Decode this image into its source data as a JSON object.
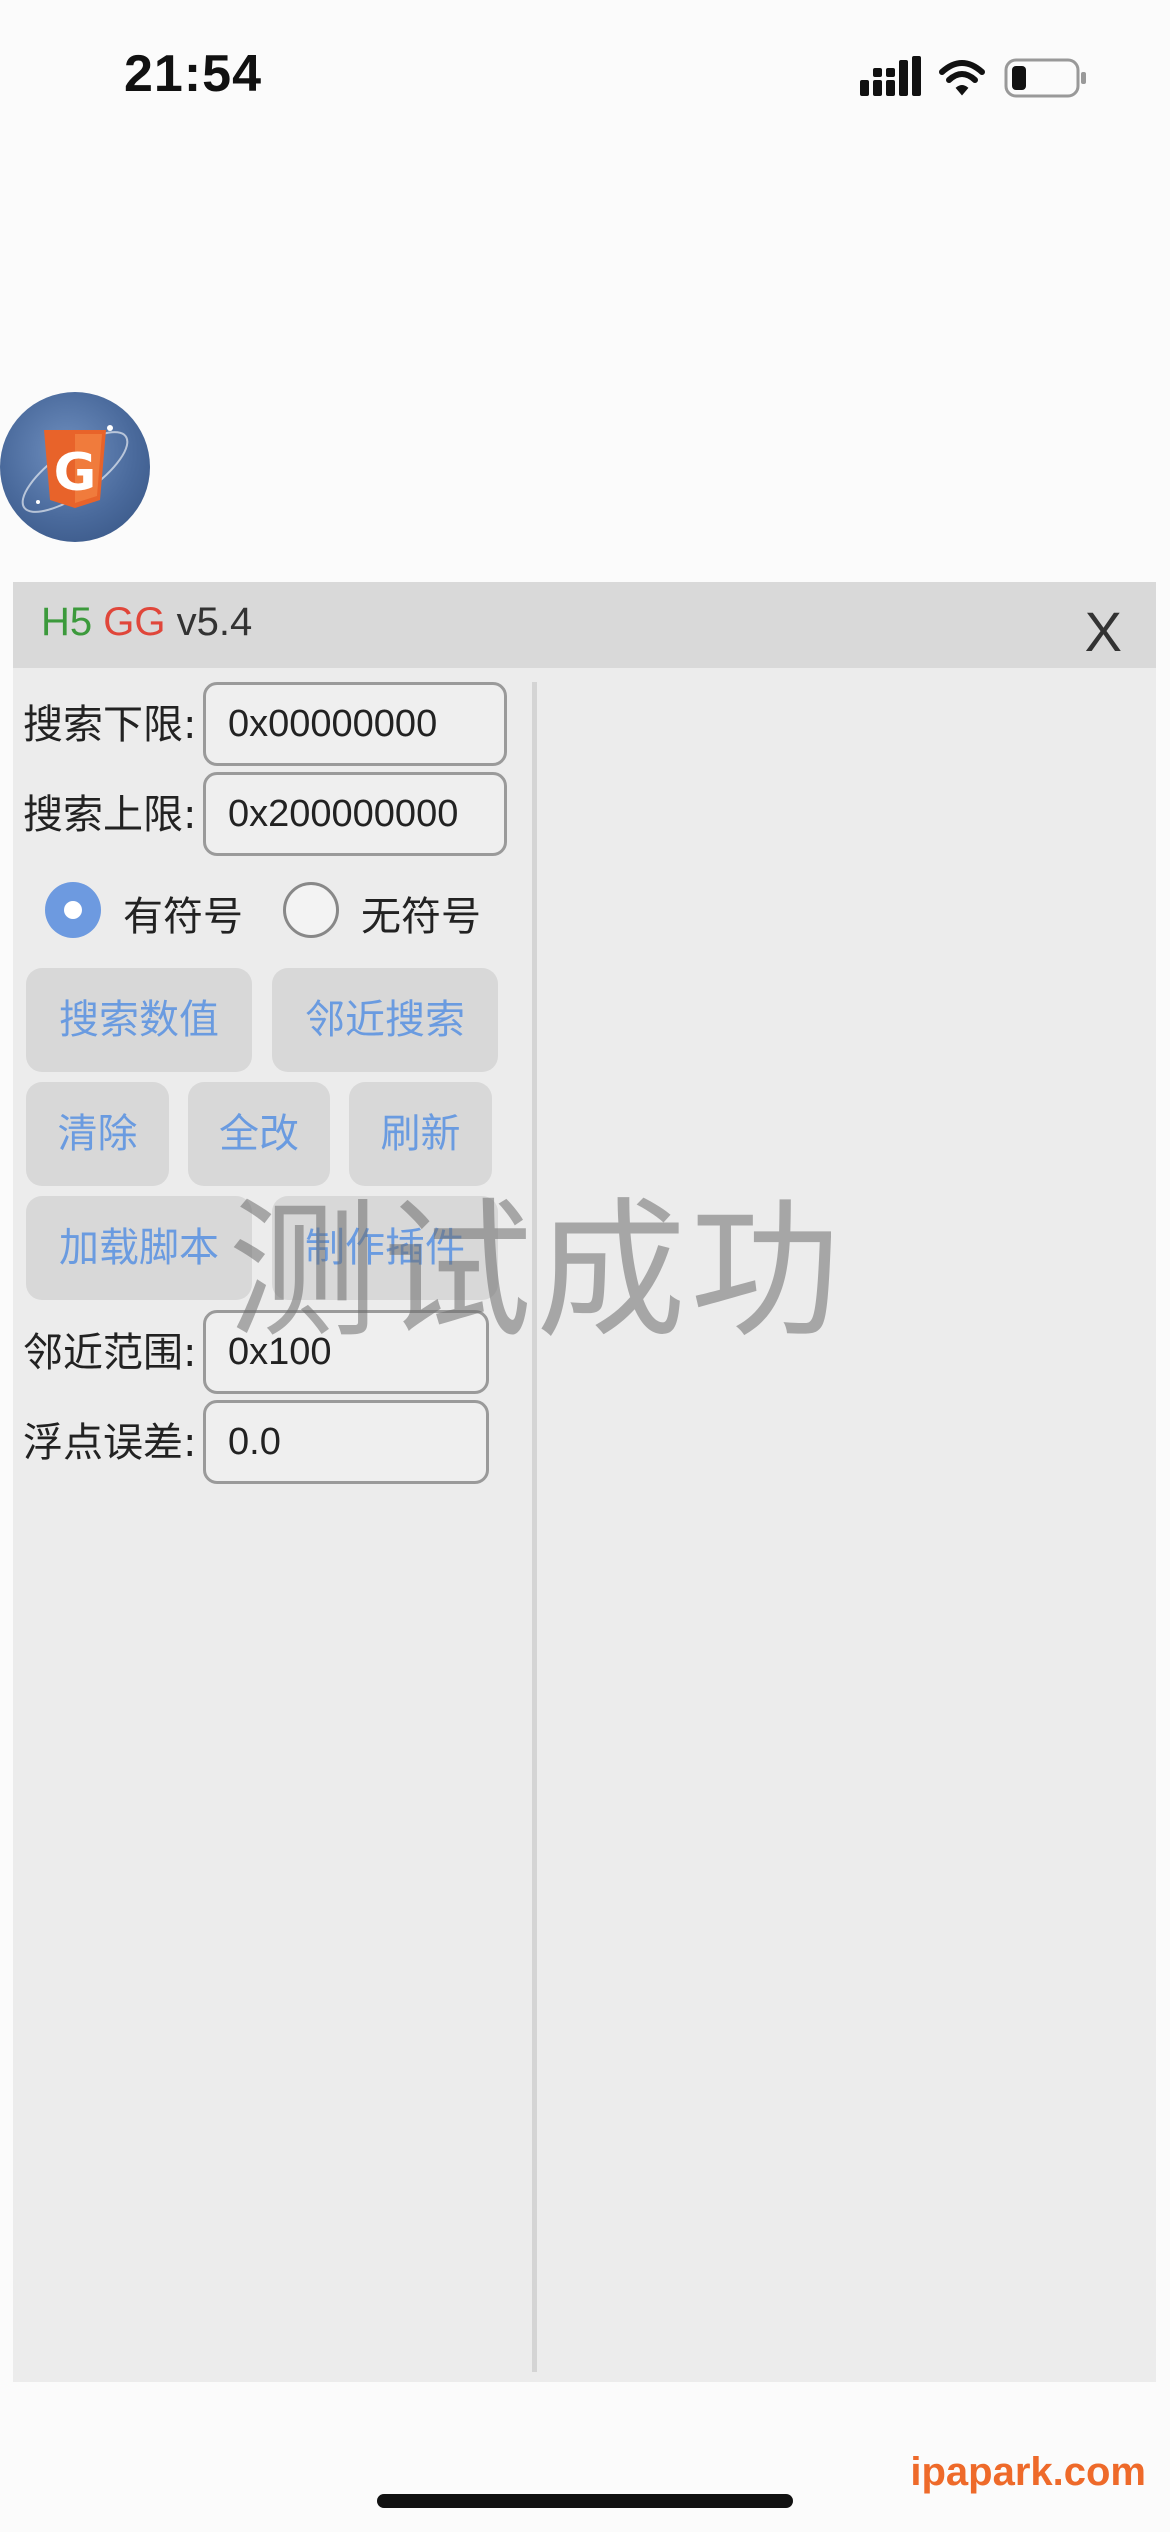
{
  "status_bar": {
    "time": "21:54",
    "icons": [
      "cellular-signal-icon",
      "wifi-icon",
      "battery-icon"
    ]
  },
  "floating_icon": {
    "icon": "h5gg-logo-icon",
    "letter": "G"
  },
  "panel": {
    "title": {
      "h5": "H5",
      "gg": "GG",
      "version": "v5.4"
    },
    "close_label": "X",
    "search_lower": {
      "label": "搜索下限:",
      "value": "0x00000000"
    },
    "search_upper": {
      "label": "搜索上限:",
      "value": "0x200000000"
    },
    "sign_options": [
      {
        "label": "有符号",
        "selected": true
      },
      {
        "label": "无符号",
        "selected": false
      }
    ],
    "buttons": {
      "search_value": "搜索数值",
      "nearby_search": "邻近搜索",
      "clear": "清除",
      "modify_all": "全改",
      "refresh": "刷新",
      "load_script": "加载脚本",
      "make_plugin": "制作插件"
    },
    "nearby_range": {
      "label": "邻近范围:",
      "value": "0x100"
    },
    "float_tolerance": {
      "label": "浮点误差:",
      "value": "0.0"
    }
  },
  "toast": "测试成功",
  "watermark": "ipapark.com",
  "colors": {
    "h5": "#3c9a3c",
    "gg": "#e0463a",
    "button_text": "#6a9be0",
    "radio_selected": "#6d9ae0",
    "watermark": "#ee6a2a"
  }
}
